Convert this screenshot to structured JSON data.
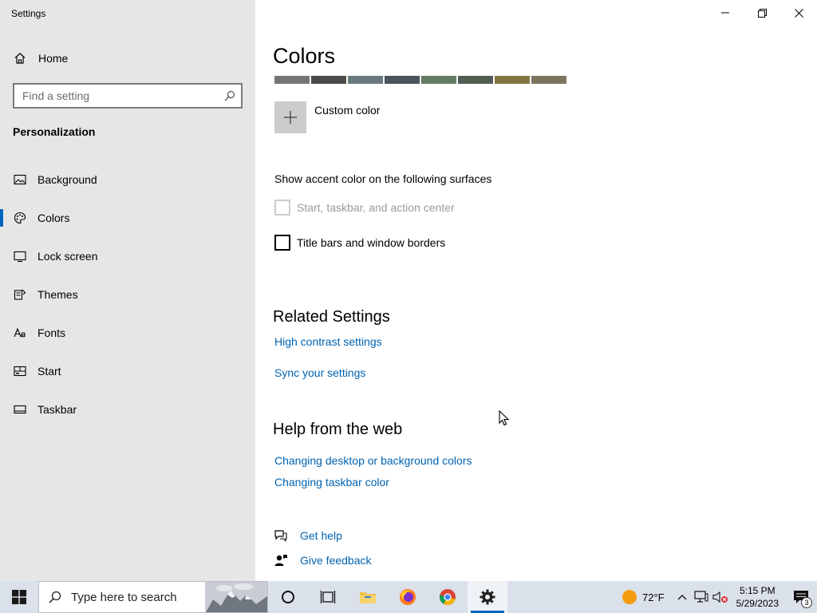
{
  "window": {
    "title": "Settings"
  },
  "sidebar": {
    "home_label": "Home",
    "search_placeholder": "Find a setting",
    "section_title": "Personalization",
    "items": [
      {
        "label": "Background",
        "icon": "picture-icon"
      },
      {
        "label": "Colors",
        "icon": "palette-icon",
        "active": true
      },
      {
        "label": "Lock screen",
        "icon": "lock-screen-icon"
      },
      {
        "label": "Themes",
        "icon": "brush-icon"
      },
      {
        "label": "Fonts",
        "icon": "font-icon"
      },
      {
        "label": "Start",
        "icon": "start-icon"
      },
      {
        "label": "Taskbar",
        "icon": "taskbar-icon"
      }
    ]
  },
  "main": {
    "title": "Colors",
    "swatch_colors": [
      "#767676",
      "#4c4a48",
      "#69797e",
      "#4a5459",
      "#647c64",
      "#525e54",
      "#847545",
      "#7e735f"
    ],
    "custom_color_label": "Custom color",
    "surfaces_title": "Show accent color on the following surfaces",
    "checkboxes": [
      {
        "label": "Start, taskbar, and action center",
        "checked": false,
        "disabled": true
      },
      {
        "label": "Title bars and window borders",
        "checked": false,
        "disabled": false
      }
    ],
    "related_title": "Related Settings",
    "related_links": [
      "High contrast settings",
      "Sync your settings"
    ],
    "help_title": "Help from the web",
    "help_links": [
      "Changing desktop or background colors",
      "Changing taskbar color"
    ],
    "get_help": "Get help",
    "give_feedback": "Give feedback"
  },
  "taskbar": {
    "search_placeholder": "Type here to search",
    "weather_temp": "72°F",
    "time": "5:15 PM",
    "date": "5/29/2023",
    "notification_count": "3"
  },
  "colors": {
    "accent": "#0067c0",
    "link": "#0063b1",
    "sidebar_bg": "#e6e6e6",
    "taskbar_bg": "#dbe1ea"
  }
}
